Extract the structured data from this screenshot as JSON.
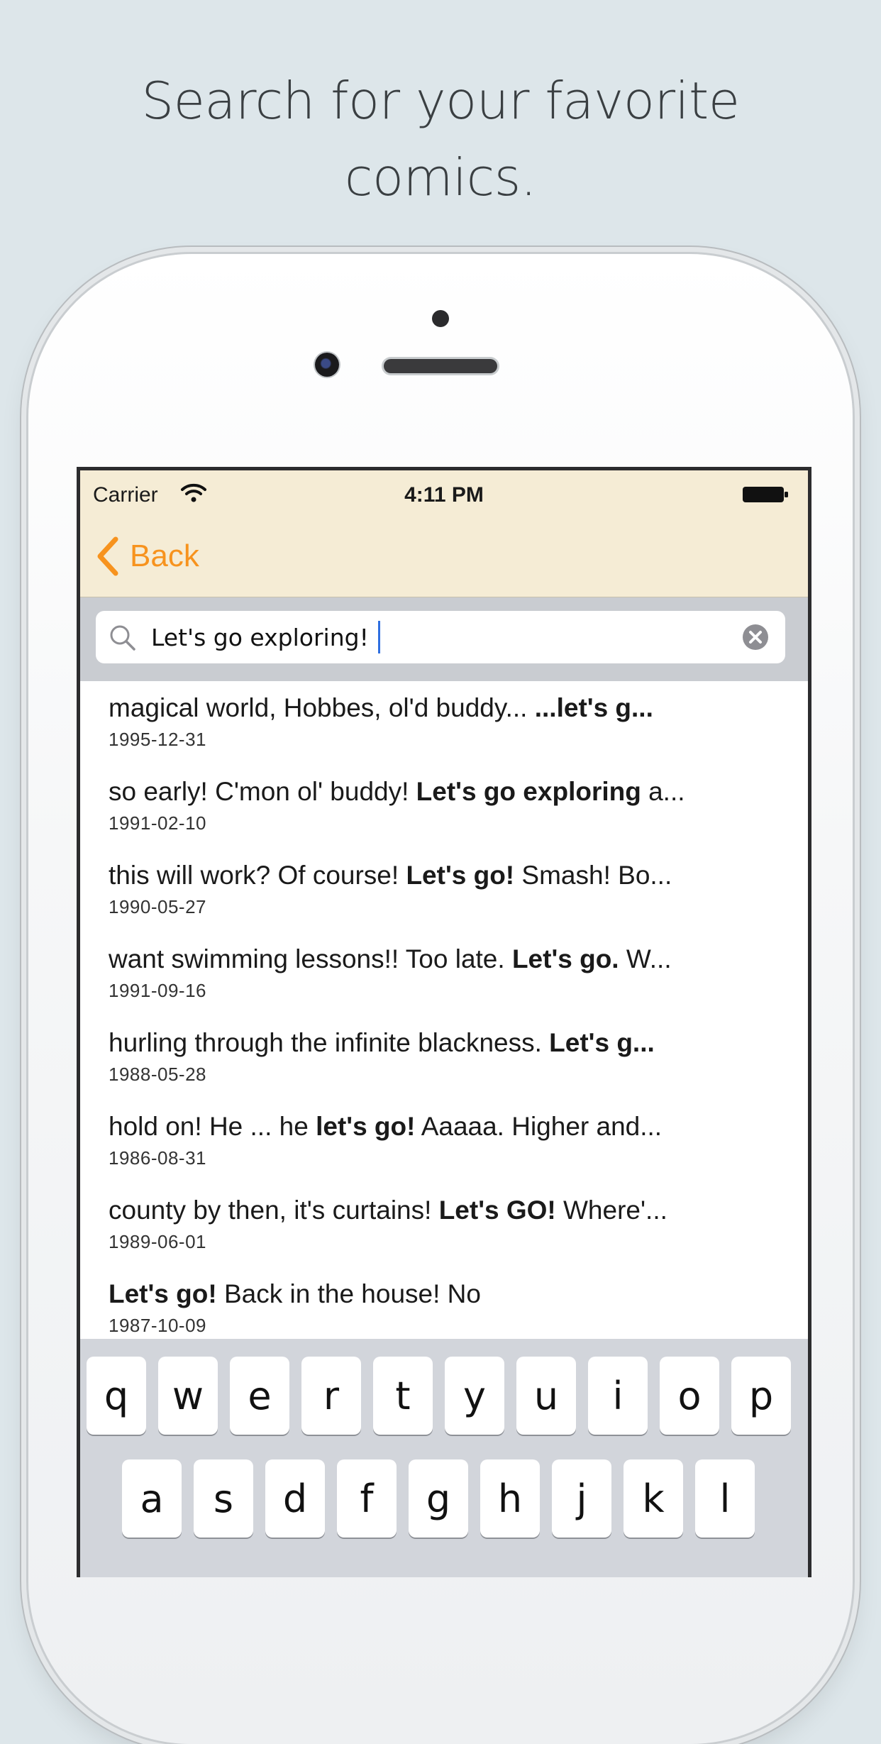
{
  "headline": {
    "line1": "Search for your favorite",
    "line2": "comics."
  },
  "status_bar": {
    "carrier": "Carrier",
    "time": "4:11 PM",
    "icons": [
      "wifi-icon",
      "battery-icon"
    ]
  },
  "nav": {
    "back_label": "Back",
    "back_icon": "chevron-left-icon",
    "accent_color": "#f7931e",
    "background_color": "#f5ecd5"
  },
  "search": {
    "value": "Let's go exploring!",
    "icons": [
      "search-icon",
      "clear-icon"
    ]
  },
  "results": [
    {
      "pre": "magical world, Hobbes, ol'd buddy... ",
      "bold": "...let's g...",
      "post": "",
      "date": "1995-12-31"
    },
    {
      "pre": "so early! C'mon ol' buddy! ",
      "bold": "Let's go exploring",
      "post": " a...",
      "date": "1991-02-10"
    },
    {
      "pre": "this will work? Of course! ",
      "bold": "Let's go!",
      "post": " Smash! Bo...",
      "date": "1990-05-27"
    },
    {
      "pre": "want swimming lessons!! Too late. ",
      "bold": "Let's go.",
      "post": " W...",
      "date": "1991-09-16"
    },
    {
      "pre": "hurling through the infinite blackness. ",
      "bold": "Let's g...",
      "post": "",
      "date": "1988-05-28"
    },
    {
      "pre": "hold on! He ... he ",
      "bold": "let's go!",
      "post": " Aaaaa. Higher and...",
      "date": "1986-08-31"
    },
    {
      "pre": "county by then, it's curtains! ",
      "bold": "Let's GO!",
      "post": " Where'...",
      "date": "1989-06-01"
    },
    {
      "pre": " ",
      "bold": "Let's go!",
      "post": " Back in the house! No",
      "date": "1987-10-09"
    }
  ],
  "keyboard": {
    "row1": [
      "q",
      "w",
      "e",
      "r",
      "t",
      "y",
      "u",
      "i",
      "o",
      "p"
    ],
    "row2": [
      "a",
      "s",
      "d",
      "f",
      "g",
      "h",
      "j",
      "k",
      "l"
    ]
  }
}
